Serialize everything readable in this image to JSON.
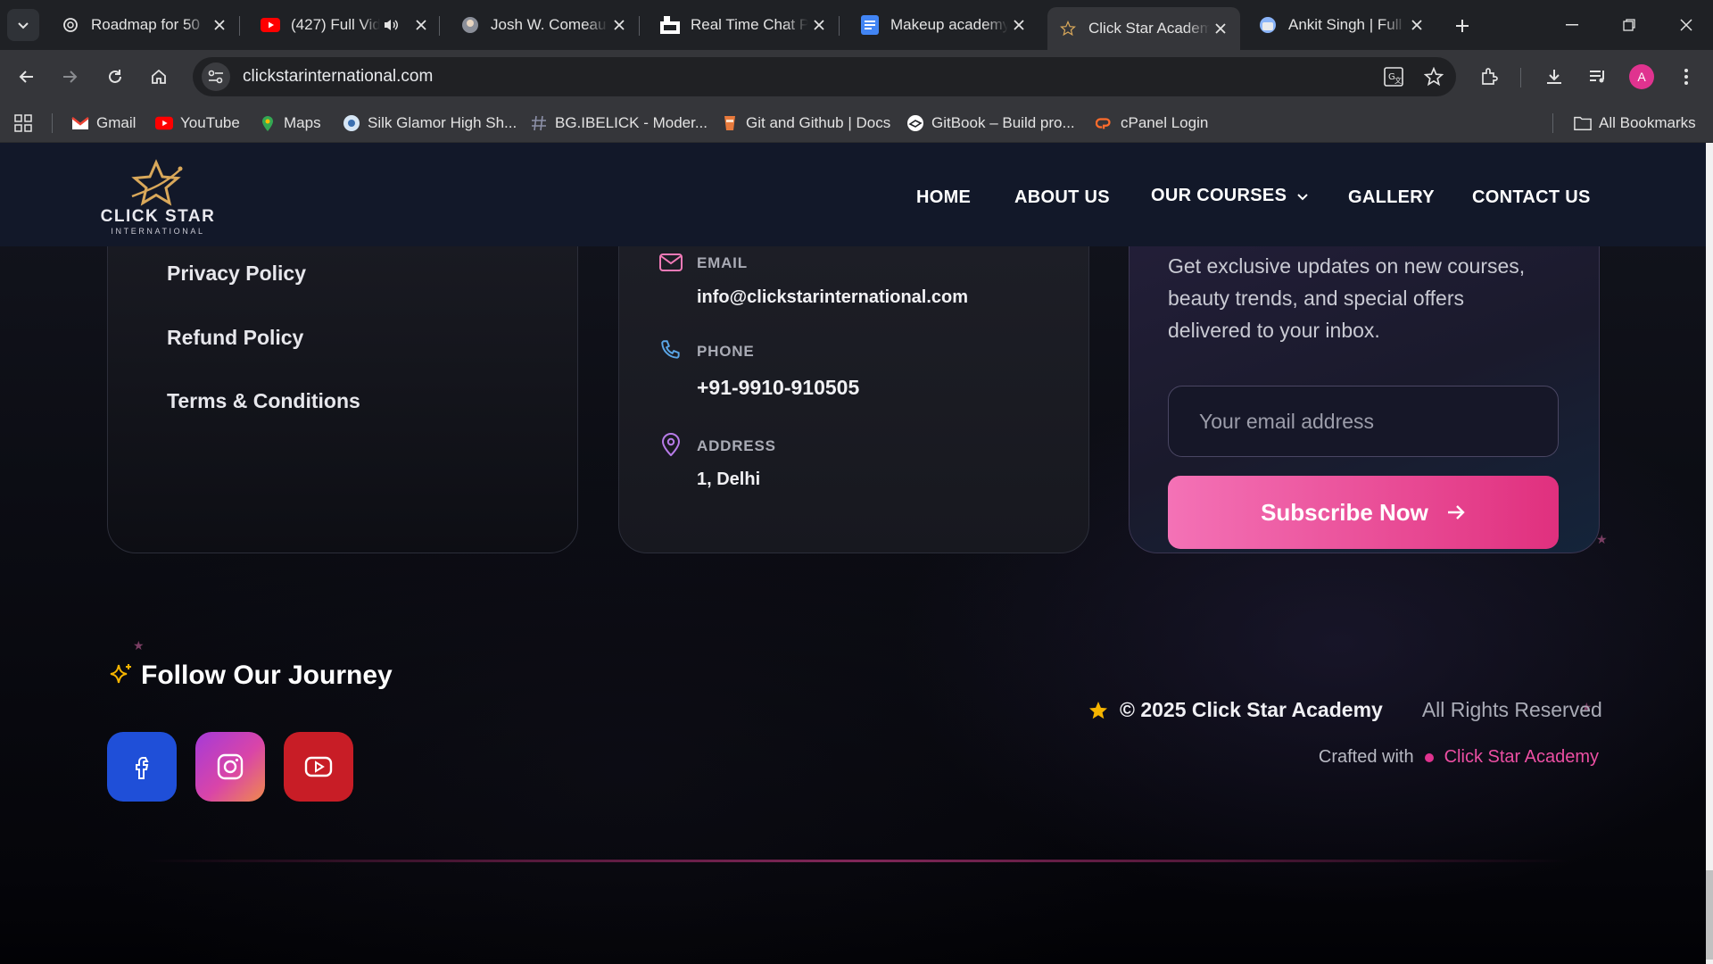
{
  "browser": {
    "tabs": [
      {
        "title": "Roadmap for 50",
        "icon": "chatgpt-icon",
        "active": false
      },
      {
        "title": "(427) Full Vid",
        "icon": "youtube-icon",
        "active": false,
        "audio": true
      },
      {
        "title": "Josh W. Comeau",
        "icon": "avatar-icon",
        "active": false
      },
      {
        "title": "Real Time Chat P",
        "icon": "chat-app-icon",
        "active": false
      },
      {
        "title": "Makeup academy",
        "icon": "docs-icon",
        "active": false
      },
      {
        "title": "Click Star Academ",
        "icon": "star-icon",
        "active": true
      },
      {
        "title": "Ankit Singh | Full",
        "icon": "globe-icon",
        "active": false
      }
    ],
    "url": "clickstarinternational.com",
    "profile_initial": "A",
    "bookmarks": [
      {
        "label": "Gmail",
        "icon": "gmail-icon"
      },
      {
        "label": "YouTube",
        "icon": "youtube-icon"
      },
      {
        "label": "Maps",
        "icon": "maps-icon"
      },
      {
        "label": "Silk Glamor High Sh...",
        "icon": "silk-icon"
      },
      {
        "label": "BG.IBELICK - Moder...",
        "icon": "hash-icon"
      },
      {
        "label": "Git and Github | Docs",
        "icon": "git-icon"
      },
      {
        "label": "GitBook – Build pro...",
        "icon": "gitbook-icon"
      },
      {
        "label": "cPanel Login",
        "icon": "cpanel-icon"
      }
    ],
    "all_bookmarks": "All Bookmarks"
  },
  "site": {
    "logo": {
      "brand": "CLICK STAR",
      "sub": "INTERNATIONAL"
    },
    "nav": {
      "home": "HOME",
      "about": "ABOUT US",
      "courses": "OUR COURSES",
      "gallery": "GALLERY",
      "contact": "CONTACT US"
    },
    "links": {
      "privacy": "Privacy Policy",
      "refund": "Refund Policy",
      "terms": "Terms & Conditions"
    },
    "contact": {
      "email_label": "EMAIL",
      "email": "info@clickstarinternational.com",
      "phone_label": "PHONE",
      "phone": "+91-9910-910505",
      "address_label": "ADDRESS",
      "address": "1, Delhi"
    },
    "newsletter": {
      "text": "Get exclusive updates on new courses, beauty trends, and special offers delivered to your inbox.",
      "placeholder": "Your email address",
      "button": "Subscribe Now"
    },
    "follow_title": "Follow Our Journey",
    "copyright": "© 2025 Click Star Academy",
    "rights": "All Rights Reserved",
    "crafted_prefix": "Crafted with",
    "crafted_name": "Click Star Academy"
  },
  "colors": {
    "accent": "#e0338f",
    "header_bg": "#121829",
    "facebook": "#1f4fd8",
    "youtube": "#c81d26",
    "star": "#f5b400"
  }
}
